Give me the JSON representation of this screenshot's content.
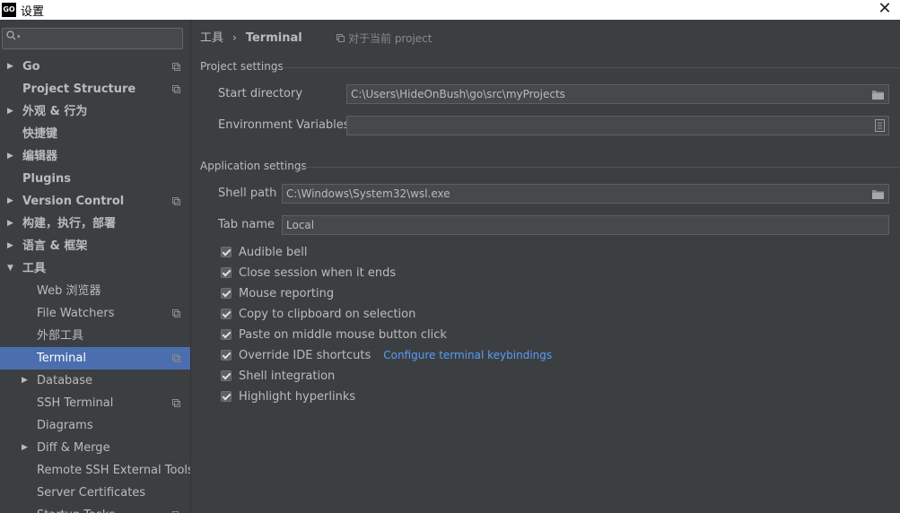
{
  "window": {
    "app_icon_text": "GO",
    "title": "设置",
    "close_glyph": "✕"
  },
  "sidebar": {
    "search_placeholder": "",
    "items": [
      {
        "label": "Go",
        "indent": 0,
        "arrow": "right",
        "bold": true,
        "project_icon": true
      },
      {
        "label": "Project Structure",
        "indent": 0,
        "arrow": "none",
        "bold": true,
        "project_icon": true
      },
      {
        "label": "外观 & 行为",
        "indent": 0,
        "arrow": "right",
        "bold": true,
        "project_icon": false
      },
      {
        "label": "快捷键",
        "indent": 0,
        "arrow": "none",
        "bold": true,
        "project_icon": false
      },
      {
        "label": "编辑器",
        "indent": 0,
        "arrow": "right",
        "bold": true,
        "project_icon": false
      },
      {
        "label": "Plugins",
        "indent": 0,
        "arrow": "none",
        "bold": true,
        "project_icon": false
      },
      {
        "label": "Version Control",
        "indent": 0,
        "arrow": "right",
        "bold": true,
        "project_icon": true
      },
      {
        "label": "构建，执行，部署",
        "indent": 0,
        "arrow": "right",
        "bold": true,
        "project_icon": false
      },
      {
        "label": "语言 & 框架",
        "indent": 0,
        "arrow": "right",
        "bold": true,
        "project_icon": false
      },
      {
        "label": "工具",
        "indent": 0,
        "arrow": "down",
        "bold": true,
        "project_icon": false
      },
      {
        "label": "Web 浏览器",
        "indent": 1,
        "arrow": "none",
        "bold": false,
        "project_icon": false
      },
      {
        "label": "File Watchers",
        "indent": 1,
        "arrow": "none",
        "bold": false,
        "project_icon": true
      },
      {
        "label": "外部工具",
        "indent": 1,
        "arrow": "none",
        "bold": false,
        "project_icon": false
      },
      {
        "label": "Terminal",
        "indent": 1,
        "arrow": "none",
        "bold": false,
        "project_icon": true,
        "selected": true
      },
      {
        "label": "Database",
        "indent": 1,
        "arrow": "right",
        "bold": false,
        "project_icon": false
      },
      {
        "label": "SSH Terminal",
        "indent": 1,
        "arrow": "none",
        "bold": false,
        "project_icon": true
      },
      {
        "label": "Diagrams",
        "indent": 1,
        "arrow": "none",
        "bold": false,
        "project_icon": false
      },
      {
        "label": "Diff & Merge",
        "indent": 1,
        "arrow": "right",
        "bold": false,
        "project_icon": false
      },
      {
        "label": "Remote SSH External Tools",
        "indent": 1,
        "arrow": "none",
        "bold": false,
        "project_icon": false
      },
      {
        "label": "Server Certificates",
        "indent": 1,
        "arrow": "none",
        "bold": false,
        "project_icon": false
      },
      {
        "label": "Startup Tasks",
        "indent": 1,
        "arrow": "none",
        "bold": false,
        "project_icon": true
      }
    ]
  },
  "breadcrumb": {
    "parent": "工具",
    "separator": "›",
    "current": "Terminal",
    "scope_note": "对于当前 project"
  },
  "project_settings": {
    "title": "Project settings",
    "start_directory_label": "Start directory",
    "start_directory_value": "C:\\Users\\HideOnBush\\go\\src\\myProjects",
    "env_vars_label": "Environment Variables",
    "env_vars_value": ""
  },
  "application_settings": {
    "title": "Application settings",
    "shell_path_label": "Shell path",
    "shell_path_value": "C:\\Windows\\System32\\wsl.exe",
    "tab_name_label": "Tab name",
    "tab_name_value": "Local",
    "checkboxes": [
      {
        "label": "Audible bell",
        "checked": true
      },
      {
        "label": "Close session when it ends",
        "checked": true
      },
      {
        "label": "Mouse reporting",
        "checked": true
      },
      {
        "label": "Copy to clipboard on selection",
        "checked": true
      },
      {
        "label": "Paste on middle mouse button click",
        "checked": true
      },
      {
        "label": "Override IDE shortcuts",
        "checked": true
      },
      {
        "label": "Shell integration",
        "checked": true
      },
      {
        "label": "Highlight hyperlinks",
        "checked": true
      }
    ],
    "keybindings_link": "Configure terminal keybindings"
  },
  "colors": {
    "background": "#3c3f41",
    "selection": "#4b6eaf",
    "link": "#589df6"
  }
}
